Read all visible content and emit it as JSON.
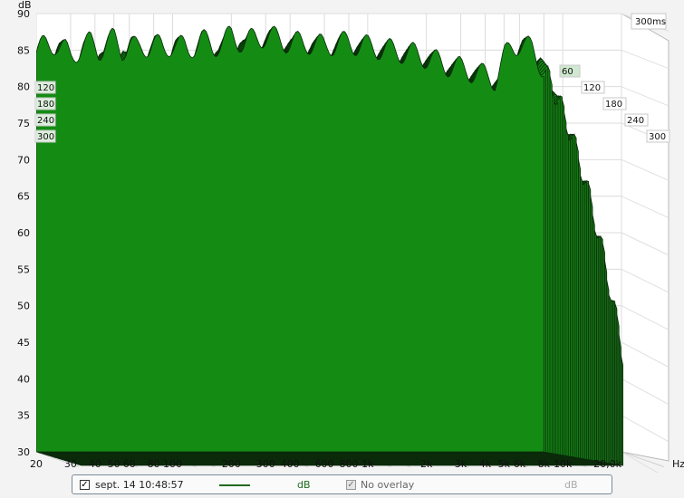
{
  "chart_data": {
    "type": "area",
    "subtype": "waterfall / cumulative spectral decay",
    "y_unit_label": "dB",
    "x_unit_label": "Hz",
    "ylim": [
      30,
      90
    ],
    "y_ticks": [
      30,
      35,
      40,
      45,
      50,
      55,
      60,
      65,
      70,
      75,
      80,
      85,
      90
    ],
    "x_scale": "log",
    "xlim": [
      20,
      20000
    ],
    "x_ticks": [
      {
        "value": 20,
        "label": "20"
      },
      {
        "value": 30,
        "label": "30"
      },
      {
        "value": 40,
        "label": "40"
      },
      {
        "value": 50,
        "label": "50"
      },
      {
        "value": 60,
        "label": "60"
      },
      {
        "value": 80,
        "label": "80"
      },
      {
        "value": 100,
        "label": "100"
      },
      {
        "value": 200,
        "label": "200"
      },
      {
        "value": 300,
        "label": "300"
      },
      {
        "value": 400,
        "label": "400"
      },
      {
        "value": 600,
        "label": "600"
      },
      {
        "value": 800,
        "label": "800"
      },
      {
        "value": 1000,
        "label": "1k"
      },
      {
        "value": 2000,
        "label": "2k"
      },
      {
        "value": 3000,
        "label": "3k"
      },
      {
        "value": 4000,
        "label": "4k"
      },
      {
        "value": 5000,
        "label": "5k"
      },
      {
        "value": 6000,
        "label": "6k"
      },
      {
        "value": 8000,
        "label": "8k"
      },
      {
        "value": 10000,
        "label": "10k"
      },
      {
        "value": 20000,
        "label": "20,0k"
      }
    ],
    "time_unit_label": "300ms",
    "time_axis_labels": [
      "60",
      "120",
      "180",
      "240",
      "300"
    ],
    "left_time_labels": [
      "120",
      "180",
      "240",
      "300"
    ],
    "series": [
      {
        "name": "sept. 14 10:48:57",
        "color": "#0f7a0f",
        "x": [
          20,
          22,
          25,
          28,
          30,
          34,
          38,
          42,
          46,
          50,
          55,
          60,
          66,
          72,
          80,
          90,
          100,
          120,
          140,
          160,
          180,
          200,
          230,
          260,
          300,
          350,
          400,
          500,
          600,
          700,
          800,
          1000,
          1300,
          1700,
          2000,
          2500,
          3000,
          3500,
          4000,
          4500,
          5000,
          5500,
          6000,
          6500,
          7000,
          8000
        ],
        "y": [
          85,
          85.5,
          86,
          85,
          84,
          85.5,
          86,
          85,
          86,
          86.5,
          85,
          86,
          85,
          85.5,
          86,
          85,
          86,
          85,
          86.5,
          85.5,
          86,
          87,
          86,
          86.5,
          87,
          86.5,
          86,
          86,
          85.5,
          86,
          86,
          85.5,
          85,
          84.5,
          84,
          83,
          82.5,
          82,
          81.5,
          81,
          84,
          85.5,
          86,
          85.5,
          85,
          84
        ]
      }
    ],
    "decay_slices": 40,
    "grid": true
  },
  "legend": {
    "series_checked": "✓",
    "series_label": "sept. 14 10:48:57",
    "series_unit": "dB",
    "overlay_checked": "✓",
    "overlay_label": "No overlay",
    "overlay_unit": "dB",
    "series_color": "#1f6b1f",
    "disabled_color": "#a0a0a0"
  }
}
